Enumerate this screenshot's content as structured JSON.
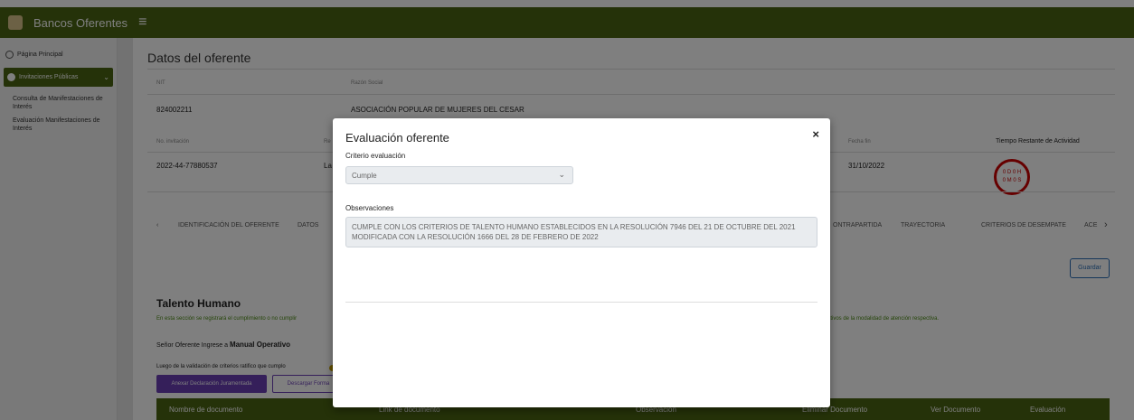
{
  "topbar": {
    "title": "Bancos Oferentes"
  },
  "sidebar": {
    "home": "Página Principal",
    "section": "Invitaciones Públicas",
    "sub1": "Consulta de Manifestaciones de Interés",
    "sub2": "Evaluación Manifestaciones de Interés"
  },
  "oferente": {
    "title": "Datos del oferente",
    "nit_label": "NIT",
    "razon_label": "Razón Social",
    "nit": "824002211",
    "razon": "ASOCIACIÓN POPULAR DE MUJERES DEL CESAR",
    "invitacion_label": "No. invitación",
    "invitacion": "2022-44-77880537",
    "partial_label": "Re",
    "partial_value": "La",
    "fecha_fin_label": "Fecha fin",
    "fecha_fin": "31/10/2022",
    "tiempo_label": "Tiempo Restante de Actividad",
    "timer_line1": "0 D 0 H",
    "timer_line2": "0 M 0 S"
  },
  "tabs": {
    "prev": "‹",
    "t1": "IDENTIFICACIÓN DEL OFERENTE",
    "t2": "DATOS",
    "t3": "ONTRAPARTIDA",
    "t4": "TRAYECTORIA",
    "t5": "CRITERIOS DE DESEMPATE",
    "t6": "ACE",
    "next": "›"
  },
  "actions": {
    "guardar": "Guardar"
  },
  "section": {
    "title": "Talento Humano",
    "desc": "En esta sección se registrará el cumplimiento o no cumplir",
    "desc_right": "ativos de la modalidad de atención respectiva.",
    "manual_prefix": "Señor Oferente Ingrese a ",
    "manual_link": "Manual Operativo",
    "luego": "Luego de la validación de criterios ratifico que cumplo",
    "btn_anexar": "Anexar Declaración Juramentada",
    "btn_descargar": "Descargar Forma"
  },
  "table": {
    "c1": "Nombre de documento",
    "c2": "Link de documento",
    "c3": "Observación",
    "c4": "Eliminar Documento",
    "c5": "Ver Documento",
    "c6": "Evaluación"
  },
  "modal": {
    "title": "Evaluación oferente",
    "close": "×",
    "criterio_label": "Criterio evaluación",
    "criterio_value": "Cumple",
    "obs_label": "Observaciones",
    "obs_value": "CUMPLE CON LOS CRITERIOS DE TALENTO HUMANO ESTABLECIDOS EN LA RESOLUCIÓN 7946 DEL 21 DE OCTUBRE DEL 2021 MODIFICADA CON LA RESOLUCIÓN 1666 DEL 28 DE FEBRERO DE 2022"
  }
}
